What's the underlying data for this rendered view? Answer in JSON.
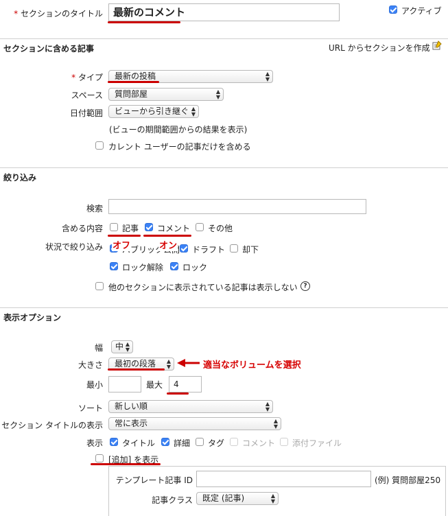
{
  "title_row": {
    "label": "セクションのタイトル",
    "value": "最新のコメント",
    "active_label": "アクティブ"
  },
  "sections": {
    "articles": "セクションに含める記事",
    "filter": "絞り込み",
    "display": "表示オプション"
  },
  "url_link": "URL からセクションを作成",
  "articles": {
    "type_label": "タイプ",
    "type_value": "最新の投稿",
    "space_label": "スペース",
    "space_value": "質問部屋",
    "date_label": "日付範囲",
    "date_value": "ビューから引き継ぐ",
    "date_note": "(ビューの期間範囲からの結果を表示)",
    "current_user_label": "カレント ユーザーの記事だけを含める"
  },
  "filter": {
    "search_label": "検索",
    "include_label": "含める内容",
    "opt_article": "記事",
    "opt_comment": "コメント",
    "opt_other": "その他",
    "status_label": "状況で絞り込み",
    "opt_public": "パブリック公開",
    "opt_draft": "ドラフト",
    "opt_rejected": "却下",
    "opt_unlock": "ロック解除",
    "opt_lock": "ロック",
    "hide_label": "他のセクションに表示されている記事は表示しない",
    "annot_off": "オフ",
    "annot_on": "オン"
  },
  "display": {
    "width_label": "幅",
    "width_value": "中",
    "size_label": "大きさ",
    "size_value": "最初の段落",
    "size_annot": "適当なボリュームを選択",
    "min_label": "最小",
    "min_value": "",
    "max_label": "最大",
    "max_value": "4",
    "sort_label": "ソート",
    "sort_value": "新しい順",
    "title_show_label": "セクション タイトルの表示",
    "title_show_value": "常に表示",
    "show_label": "表示",
    "opt_title": "タイトル",
    "opt_detail": "詳細",
    "opt_tag": "タグ",
    "opt_comment": "コメント",
    "opt_attach": "添付ファイル",
    "add_label": "[追加] を表示",
    "tpl_label": "テンプレート記事 ID",
    "tpl_value": "",
    "tpl_example": "(例) 質問部屋250",
    "class_label": "記事クラス",
    "class_value": "既定 (記事)"
  },
  "colors": {
    "accent": "#3b82f6",
    "annotation": "#cc0000",
    "separator": "#cfcfcf"
  }
}
